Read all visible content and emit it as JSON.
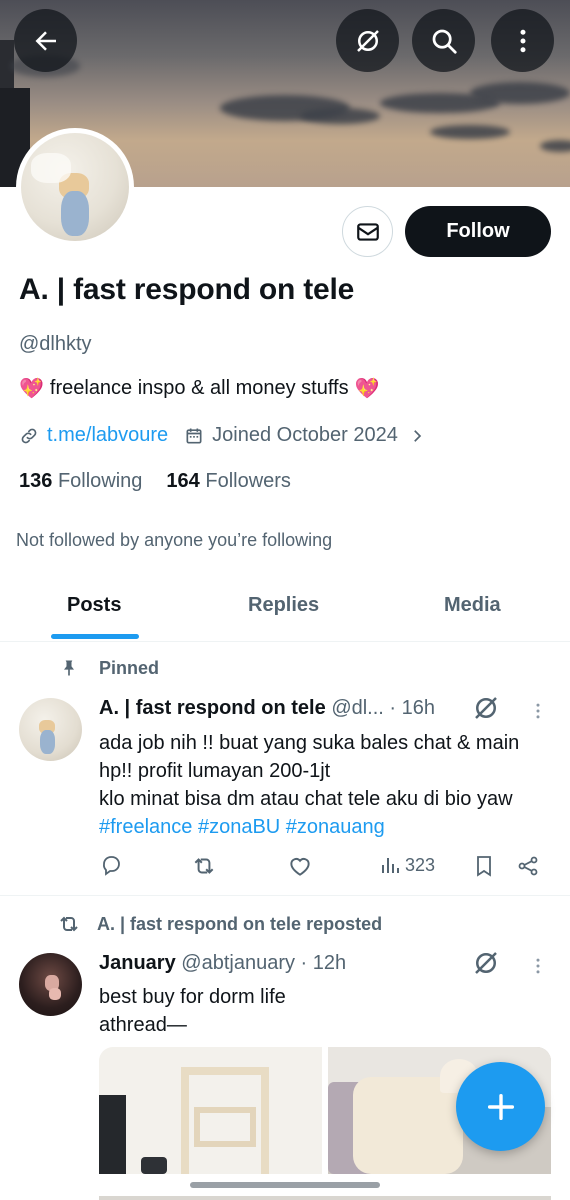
{
  "profile": {
    "display_name": "A. | fast respond on tele",
    "handle": "@dlhkty",
    "bio_text": "freelance inspo & all money stuffs",
    "bio_emoji": "💖",
    "link": "t.me/labvoure",
    "joined": "Joined October 2024",
    "following_count": "136",
    "following_label": "Following",
    "followers_count": "164",
    "followers_label": "Followers",
    "not_followed": "Not followed by anyone you’re following",
    "follow_label": "Follow"
  },
  "tabs": [
    {
      "label": "Posts",
      "active": true
    },
    {
      "label": "Replies",
      "active": false
    },
    {
      "label": "Media",
      "active": false
    }
  ],
  "post1": {
    "pinned_label": "Pinned",
    "author": "A. | fast respond on tele",
    "handle": "@dl...",
    "time": "· 16h",
    "line1": "ada job nih !! buat yang suka bales chat & main",
    "line2": "hp!! profit lumayan 200-1jt",
    "line3": "klo minat bisa dm atau chat tele aku di bio yaw",
    "tags": "#freelance #zonaBU #zonauang",
    "views": "323"
  },
  "post2": {
    "repost_label": "A. | fast respond on tele reposted",
    "author": "January",
    "handle": "@abtjanuary",
    "time": "· 12h",
    "line1": "best buy for dorm life",
    "line2": "athread—"
  },
  "colors": {
    "accent": "#1d9bf0",
    "text": "#0f1419",
    "muted": "#536471",
    "heart": "#f0508f"
  },
  "icons": [
    "back-arrow-icon",
    "grok-icon",
    "search-icon",
    "more-vertical-icon",
    "mail-icon",
    "link-icon",
    "calendar-icon",
    "chevron-right-icon",
    "pin-icon",
    "reply-icon",
    "repost-icon",
    "like-icon",
    "views-icon",
    "bookmark-icon",
    "share-icon",
    "plus-icon"
  ]
}
